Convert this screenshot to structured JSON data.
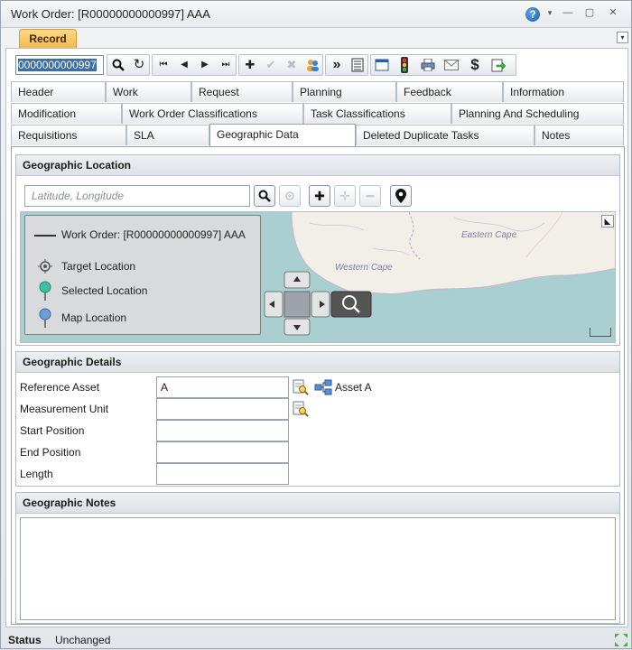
{
  "window": {
    "title": "Work Order: [R00000000000997] AAA",
    "help_glyph": "?",
    "dropdown_glyph": "▾",
    "minimize_glyph": "—",
    "maximize_glyph": "▢",
    "close_glyph": "✕"
  },
  "record_tab": {
    "label": "Record",
    "collapse_glyph": "▾"
  },
  "toolbar": {
    "record_id": "0000000000997",
    "buttons": {
      "search": "search-icon",
      "refresh": "refresh-icon",
      "first": "⏮",
      "prev": "◀",
      "next": "▶",
      "last": "⏭",
      "add": "✚",
      "save": "✔",
      "cancel": "✖",
      "more": "»",
      "dollar": "$"
    }
  },
  "tabs": {
    "row1": [
      "Header",
      "Work",
      "Request",
      "Planning",
      "Feedback",
      "Information"
    ],
    "row2": [
      "Modification",
      "Work Order Classifications",
      "Task Classifications",
      "Planning And Scheduling"
    ],
    "row3": [
      "Requisitions",
      "SLA",
      "Geographic Data",
      "Deleted Duplicate Tasks",
      "Notes"
    ],
    "active": "Geographic Data"
  },
  "geographic_location": {
    "title": "Geographic Location",
    "search_placeholder": "Latitude, Longitude",
    "legend": {
      "work_order": "Work Order: [R00000000000997] AAA",
      "target": "Target Location",
      "selected": "Selected Location",
      "map": "Map Location"
    },
    "map_labels": {
      "western_cape": "Western Cape",
      "eastern_cape": "Eastern Cape"
    }
  },
  "geographic_details": {
    "title": "Geographic Details",
    "fields": {
      "reference_asset": {
        "label": "Reference Asset",
        "value": "A",
        "link": "Asset A"
      },
      "measurement_unit": {
        "label": "Measurement Unit",
        "value": ""
      },
      "start_position": {
        "label": "Start Position",
        "value": ""
      },
      "end_position": {
        "label": "End Position",
        "value": ""
      },
      "length": {
        "label": "Length",
        "value": ""
      }
    }
  },
  "geographic_notes": {
    "title": "Geographic Notes",
    "value": ""
  },
  "status": {
    "label": "Status",
    "value": "Unchanged"
  },
  "colors": {
    "record_tab": "#f5b548",
    "map_sea": "#a9cfd0",
    "map_land": "#f2efe9"
  }
}
